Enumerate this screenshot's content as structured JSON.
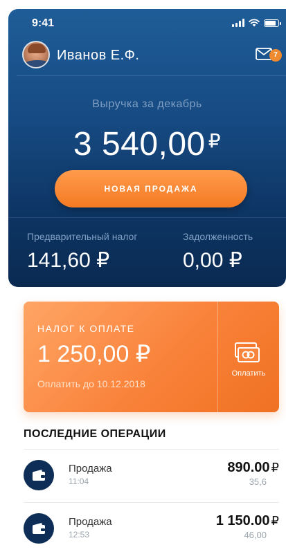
{
  "status_bar": {
    "time": "9:41"
  },
  "header": {
    "user_name": "Иванов Е.Ф.",
    "mail_badge_count": "7"
  },
  "revenue": {
    "label": "Выручка за декабрь",
    "amount": "3 540,00",
    "currency": "₽"
  },
  "new_sale_button": {
    "label": "НОВАЯ ПРОДАЖА"
  },
  "stats": {
    "prelim_tax": {
      "label": "Предварительный налог",
      "value": "141,60 ₽"
    },
    "debt": {
      "label": "Задолженность",
      "value": "0,00 ₽"
    }
  },
  "tax_card": {
    "title": "НАЛОГ К ОПЛАТЕ",
    "amount": "1 250,00 ₽",
    "due": "Оплатить до 10.12.2018",
    "pay_label": "Оплатить"
  },
  "operations": {
    "title": "ПОСЛЕДНИЕ ОПЕРАЦИИ",
    "items": [
      {
        "name": "Продажа",
        "time": "11:04",
        "amount": "890.00",
        "currency": "₽",
        "tax": "35,6"
      },
      {
        "name": "Продажа",
        "time": "12:53",
        "amount": "1 150.00",
        "currency": "₽",
        "tax": "46,00"
      }
    ]
  },
  "colors": {
    "hero_top": "#1f5d98",
    "hero_bottom": "#0a2a52",
    "accent_orange": "#f47a22",
    "icon_navy": "#0f2e57"
  },
  "icons": [
    "signal-icon",
    "wifi-icon",
    "battery-icon",
    "mail-icon",
    "card-payment-icon",
    "wallet-icon"
  ]
}
